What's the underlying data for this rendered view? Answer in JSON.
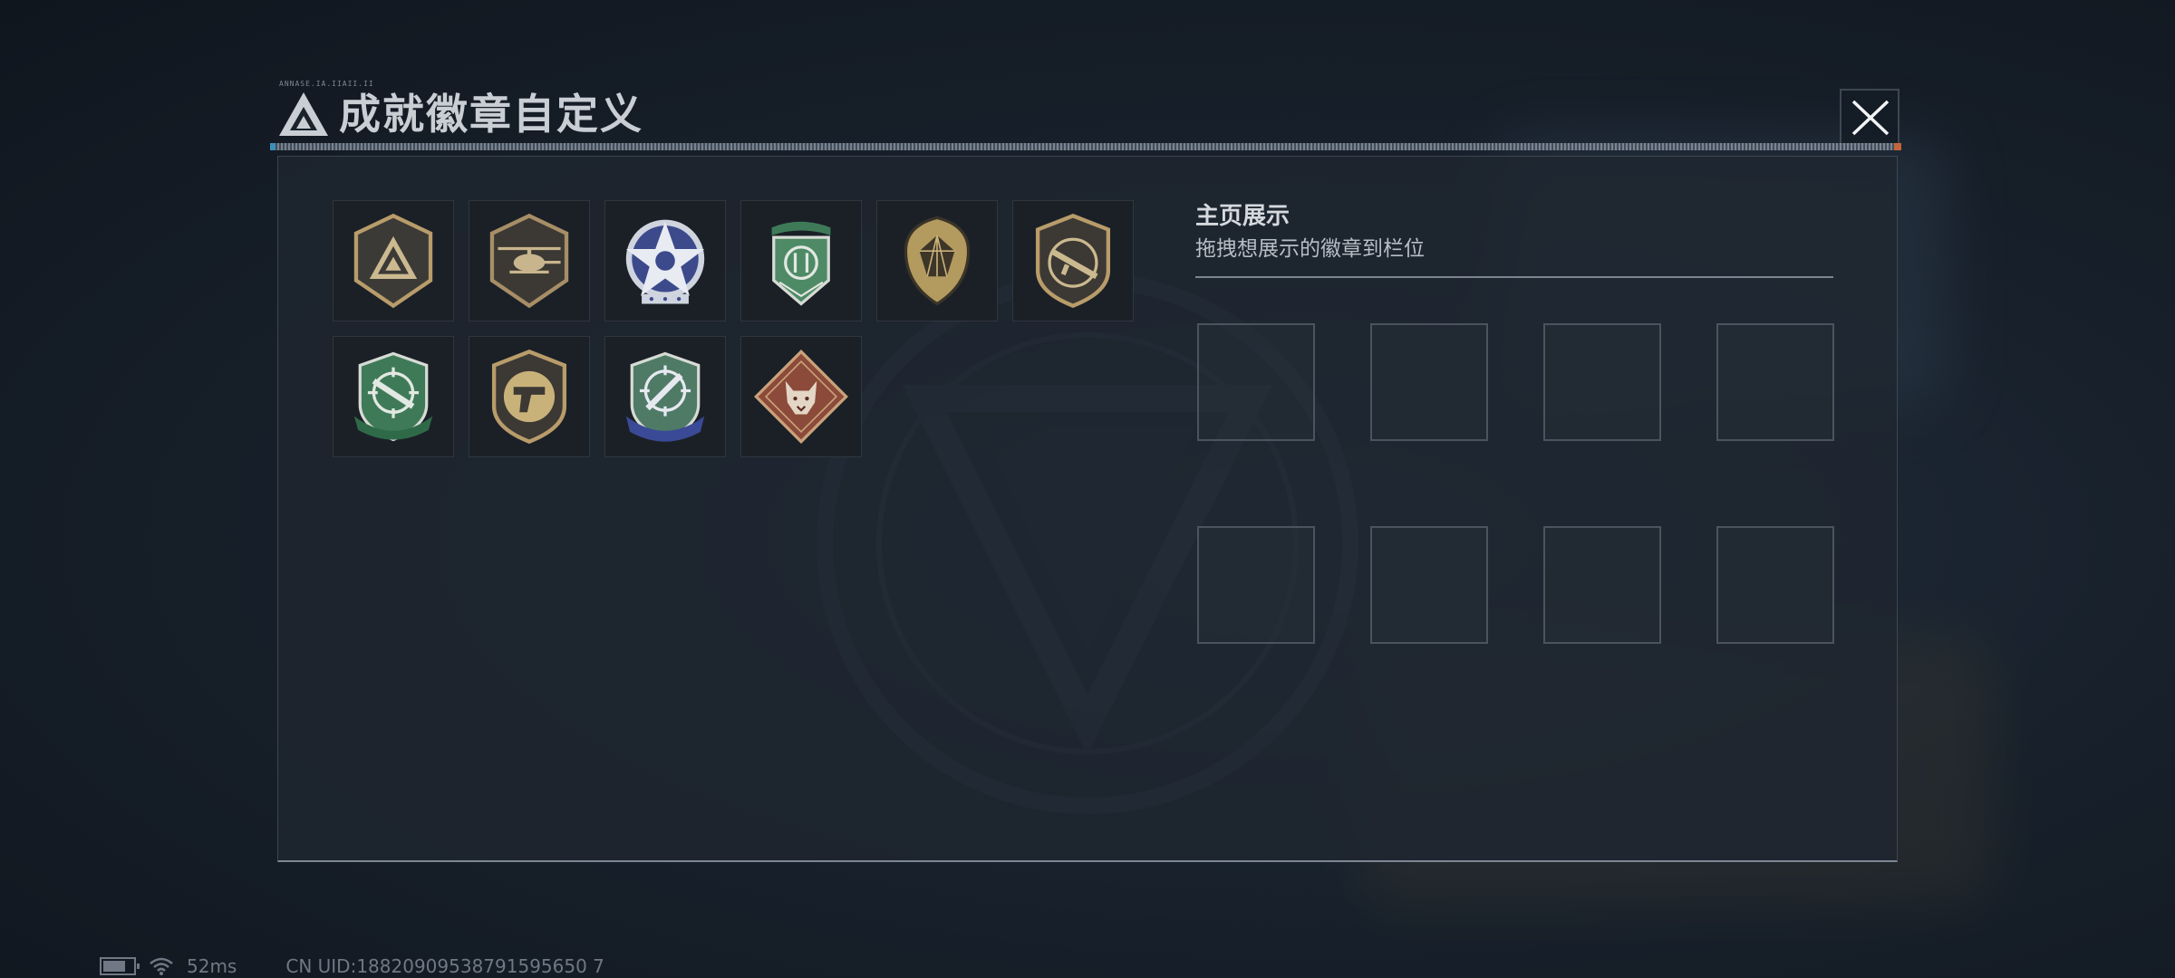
{
  "dialog": {
    "title": "成就徽章自定义",
    "header_code": "ANNASE.IA.IIAII.II",
    "close_icon": "close-x-icon",
    "logo_icon": "triangle-logo-icon"
  },
  "badges": [
    {
      "name": "triangle-shield-badge",
      "color": "#b89c6a"
    },
    {
      "name": "helicopter-shield-badge",
      "color": "#a78e66"
    },
    {
      "name": "blue-star-badge",
      "color": "#5867a8"
    },
    {
      "name": "green-ribbon-badge",
      "color": "#4e8a66"
    },
    {
      "name": "gem-shield-badge",
      "color": "#b39a5e"
    },
    {
      "name": "rifle-shield-badge",
      "color": "#b89c6a"
    },
    {
      "name": "green-rifle-crosshair-badge",
      "color": "#4e8a66"
    },
    {
      "name": "pistol-shield-badge",
      "color": "#b89c6a"
    },
    {
      "name": "blue-knife-crosshair-badge",
      "color": "#4e5ea6"
    },
    {
      "name": "wolf-diamond-badge",
      "color": "#8b4a3a"
    }
  ],
  "showcase": {
    "title": "主页展示",
    "subtitle": "拖拽想展示的徽章到栏位",
    "slot_count": 8
  },
  "status": {
    "ping": "52ms",
    "uid": "CN UID:18820909538791595650 7"
  }
}
